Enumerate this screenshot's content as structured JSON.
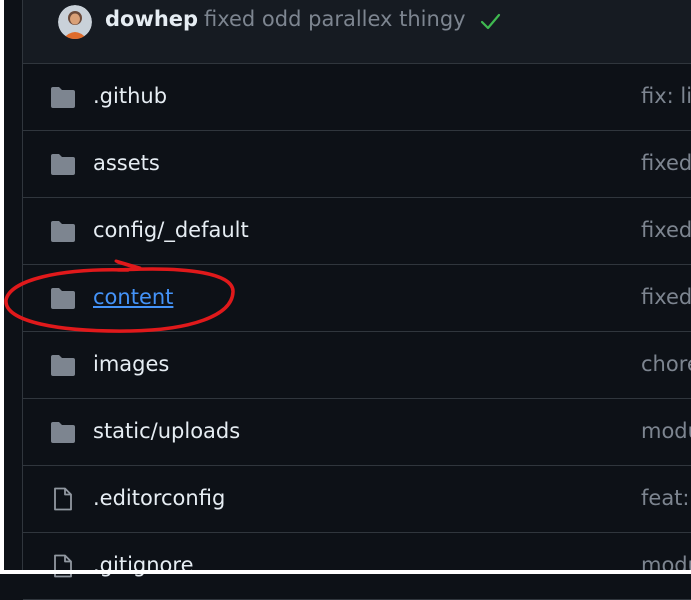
{
  "commit": {
    "author": "dowhep",
    "message": "fixed odd parallex thingy",
    "status_icon": "check-icon"
  },
  "files": [
    {
      "type": "folder",
      "name": ".github",
      "message": "fix: lir"
    },
    {
      "type": "folder",
      "name": "assets",
      "message": "fixed"
    },
    {
      "type": "folder",
      "name": "config/_default",
      "message": "fixed"
    },
    {
      "type": "folder",
      "name": "content",
      "message": "fixed",
      "highlighted": true
    },
    {
      "type": "folder",
      "name": "images",
      "message": "chore"
    },
    {
      "type": "folder",
      "name": "static/uploads",
      "message": "modu"
    },
    {
      "type": "file",
      "name": ".editorconfig",
      "message": "feat:"
    },
    {
      "type": "file",
      "name": ".gitignore",
      "message": "modu"
    }
  ],
  "colors": {
    "background": "#0d1117",
    "link": "#4493f8",
    "muted": "#7d8590",
    "success": "#3fb950",
    "annotation": "#e0191b"
  }
}
